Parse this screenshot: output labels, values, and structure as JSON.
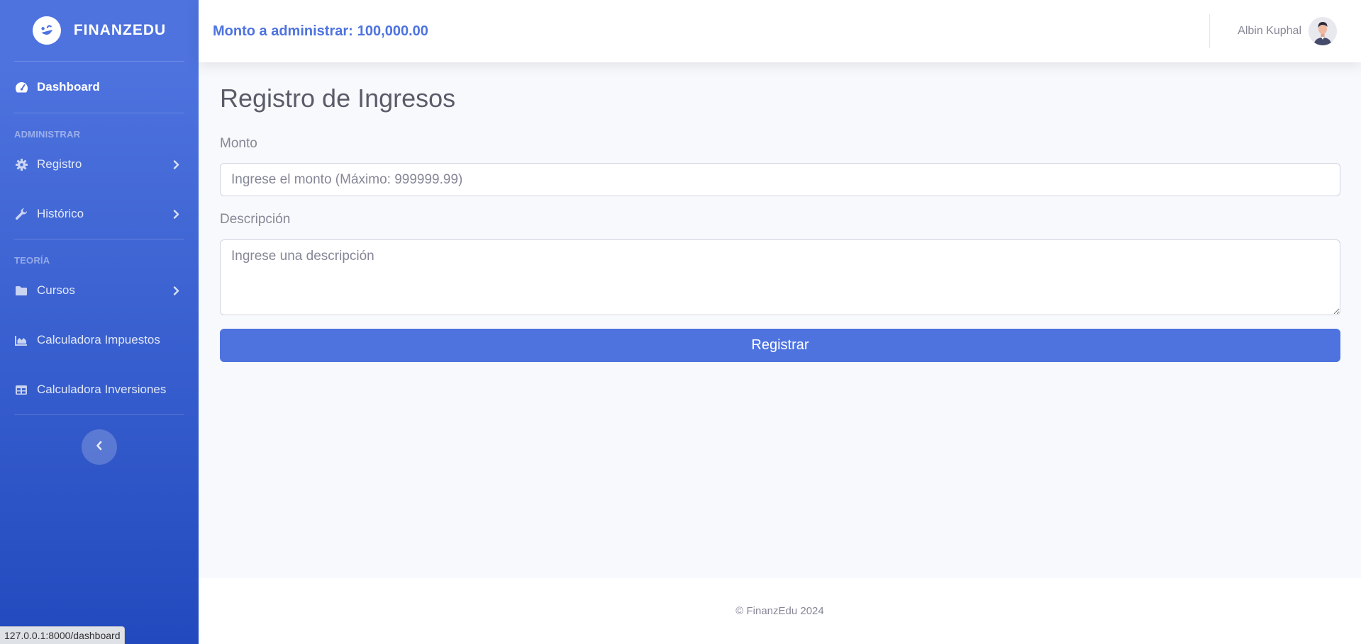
{
  "brand": {
    "name": "FINANZEDU"
  },
  "sidebar": {
    "dashboard": "Dashboard",
    "heading_admin": "ADMINISTRAR",
    "items_admin": [
      {
        "label": "Registro"
      },
      {
        "label": "Histórico"
      }
    ],
    "heading_teoria": "TEORÍA",
    "items_teoria": [
      {
        "label": "Cursos"
      },
      {
        "label": "Calculadora Impuestos"
      },
      {
        "label": "Calculadora Inversiones"
      }
    ]
  },
  "topbar": {
    "monto_label": "Monto a administrar:",
    "monto_value": "100,000.00",
    "user_name": "Albin Kuphal"
  },
  "form": {
    "title": "Registro de Ingresos",
    "monto_label": "Monto",
    "monto_placeholder": "Ingrese el monto (Máximo: 999999.99)",
    "descripcion_label": "Descripción",
    "descripcion_placeholder": "Ingrese una descripción",
    "submit_label": "Registrar"
  },
  "footer": {
    "text": "© FinanzEdu 2024"
  },
  "status_bar": {
    "url": "127.0.0.1:8000/dashboard"
  },
  "colors": {
    "primary": "#4e73df",
    "primary_dark": "#224abe",
    "text_muted": "#858796"
  },
  "icons": {
    "brand": "laugh-wink-icon",
    "dashboard": "tachometer-icon",
    "registro": "cog-icon",
    "historico": "wrench-icon",
    "cursos": "folder-icon",
    "impuestos": "chart-area-icon",
    "inversiones": "table-icon"
  }
}
